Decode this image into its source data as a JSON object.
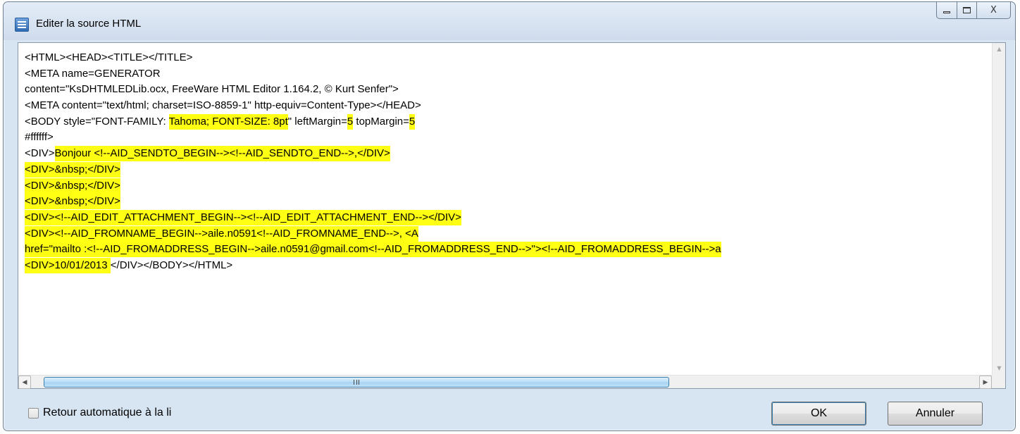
{
  "window": {
    "title": "Editer la source HTML",
    "minimize_glyph": "",
    "close_glyph": "X"
  },
  "editor": {
    "lines": [
      [
        {
          "t": "<HTML><HEAD><TITLE></TITLE>"
        }
      ],
      [
        {
          "t": "<META name=GENERATOR"
        }
      ],
      [
        {
          "t": "content=\"KsDHTMLEDLib.ocx, FreeWare HTML Editor 1.164.2, © Kurt Senfer\">"
        }
      ],
      [
        {
          "t": "<META content=\"text/html; charset=ISO-8859-1\" http-equiv=Content-Type></HEAD>"
        }
      ],
      [
        {
          "t": "<BODY style=\"FONT-FAMILY: "
        },
        {
          "t": "Tahoma; FONT-SIZE: 8pt",
          "h": true
        },
        {
          "t": "\" leftMargin="
        },
        {
          "t": "5",
          "h": true
        },
        {
          "t": " topMargin="
        },
        {
          "t": "5",
          "h": true
        }
      ],
      [
        {
          "t": "#ffffff>"
        }
      ],
      [
        {
          "t": "<DIV>"
        },
        {
          "t": "Bonjour <!--AID_SENDTO_BEGIN--><!--AID_SENDTO_END-->,</DIV>",
          "h": true
        }
      ],
      [
        {
          "t": "<DIV>&nbsp;</DIV>",
          "h": true
        }
      ],
      [
        {
          "t": "<DIV>&nbsp;</DIV>",
          "h": true
        }
      ],
      [
        {
          "t": "<DIV>&nbsp;</DIV>",
          "h": true
        }
      ],
      [
        {
          "t": "<DIV><!--AID_EDIT_ATTACHMENT_BEGIN--><!--AID_EDIT_ATTACHMENT_END--></DIV>",
          "h": true
        }
      ],
      [
        {
          "t": "<DIV><!--AID_FROMNAME_BEGIN-->aile.n0591<!--AID_FROMNAME_END-->, <A",
          "h": true
        }
      ],
      [
        {
          "t": "href=\"mailto :<!--AID_FROMADDRESS_BEGIN-->aile.n0591@gmail.com<!--AID_FROMADDRESS_END-->\"><!--AID_FROMADDRESS_BEGIN-->a",
          "h": true
        }
      ],
      [
        {
          "t": "<DIV>10/01/2013 ",
          "h": true
        },
        {
          "t": "</DIV></BODY></HTML>"
        }
      ]
    ],
    "highlight_color": "#ffff14"
  },
  "options": {
    "word_wrap_label": "Retour automatique à la li",
    "word_wrap_checked": false
  },
  "buttons": {
    "ok_label": "OK",
    "cancel_label": "Annuler"
  },
  "icons": {
    "app": "html-editor-icon",
    "minimize": "minimize-icon",
    "maximize": "maximize-icon",
    "close": "close-icon"
  }
}
